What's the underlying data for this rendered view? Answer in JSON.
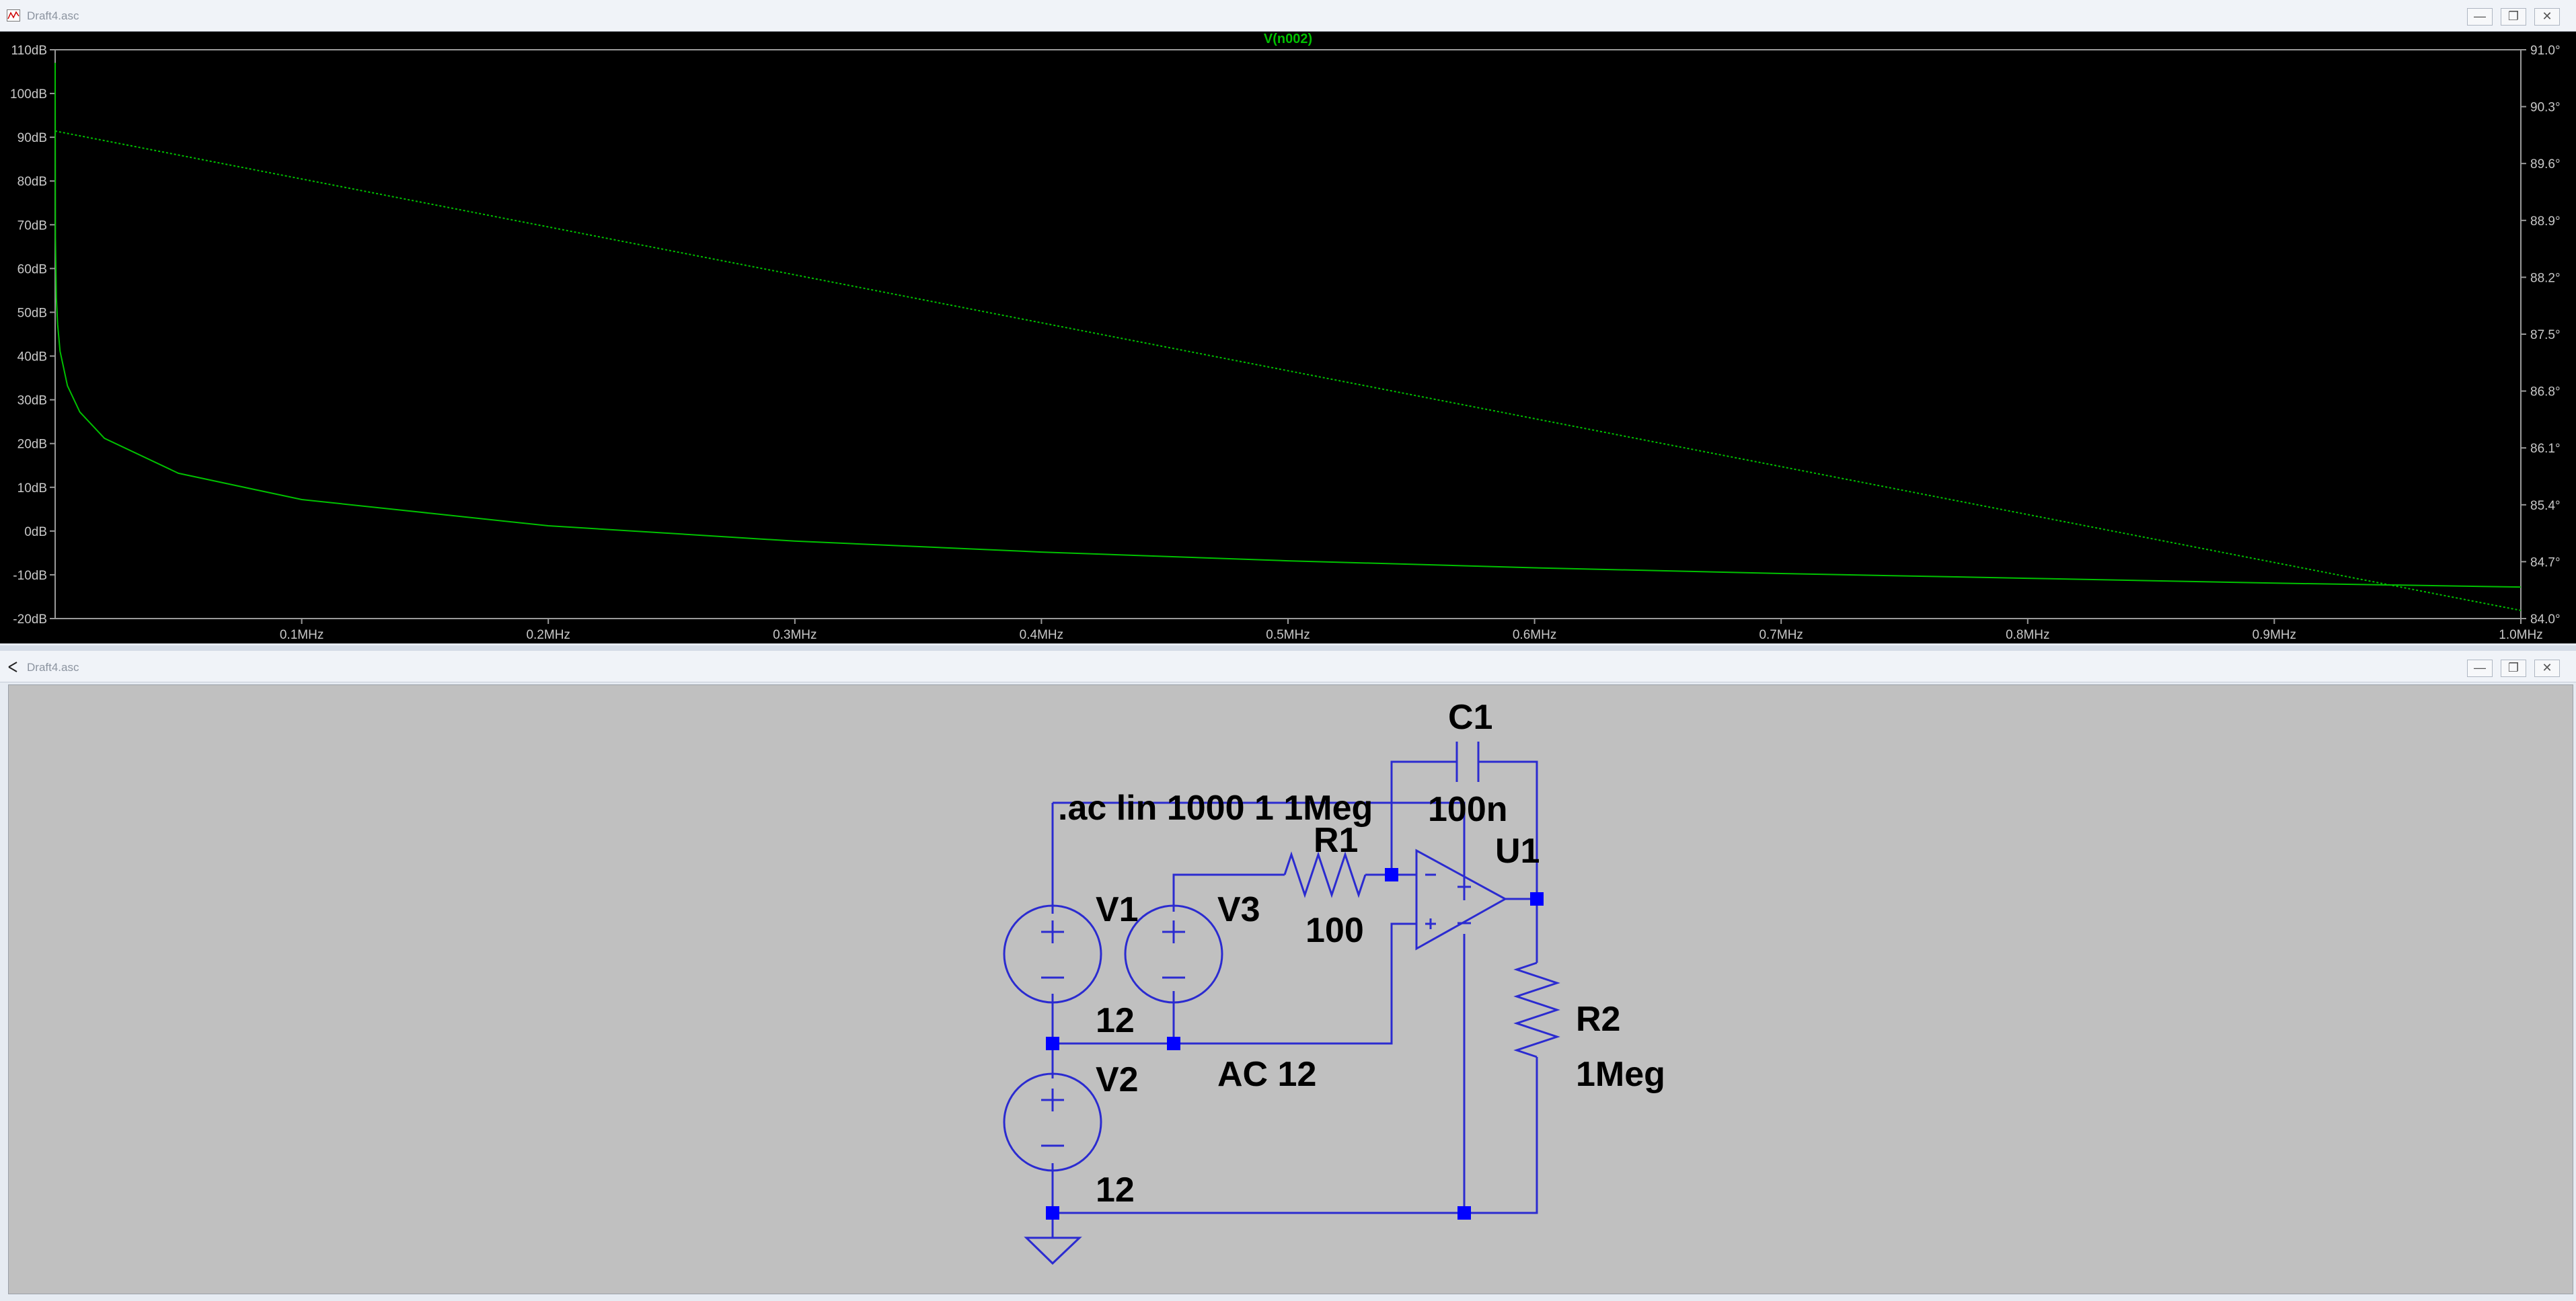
{
  "waveform_window": {
    "title": "Draft4.asc",
    "controls": [
      "—",
      "❐",
      "✕"
    ]
  },
  "schematic_window": {
    "title": "Draft4.asc",
    "controls": [
      "—",
      "❐",
      "✕"
    ]
  },
  "chart_data": {
    "type": "line",
    "title": "V(n002)",
    "xlabel": "",
    "ylabel": "",
    "x_ticks": [
      "0.1MHz",
      "0.2MHz",
      "0.3MHz",
      "0.4MHz",
      "0.5MHz",
      "0.6MHz",
      "0.7MHz",
      "0.8MHz",
      "0.9MHz",
      "1.0MHz"
    ],
    "y_left_ticks": [
      "110dB",
      "100dB",
      "90dB",
      "80dB",
      "70dB",
      "60dB",
      "50dB",
      "40dB",
      "30dB",
      "20dB",
      "10dB",
      "0dB",
      "-10dB",
      "-20dB"
    ],
    "y_right_ticks": [
      "91.0°",
      "90.3°",
      "89.6°",
      "88.9°",
      "88.2°",
      "87.5°",
      "86.8°",
      "86.1°",
      "85.4°",
      "84.7°",
      "84.0°"
    ],
    "xlim_mhz": [
      0,
      1.0
    ],
    "ylim_db": [
      -20,
      110
    ],
    "ylim_deg": [
      84.0,
      91.0
    ],
    "grid": false,
    "color": "#00c000",
    "series": [
      {
        "kind": "magnitude",
        "x_mhz": [
          1e-06,
          0.0001,
          0.0005,
          0.001,
          0.002,
          0.005,
          0.01,
          0.02,
          0.05,
          0.1,
          0.2,
          0.3,
          0.4,
          0.5,
          0.6,
          0.7,
          0.8,
          0.9,
          1.0
        ],
        "y_db": [
          107,
          67,
          53.2,
          47.2,
          41.1,
          33.2,
          27.2,
          21.2,
          13.2,
          7.2,
          1.2,
          -2.3,
          -4.8,
          -6.8,
          -8.4,
          -9.7,
          -10.8,
          -11.9,
          -12.8
        ]
      },
      {
        "kind": "phase",
        "x_mhz": [
          1e-06,
          1.0
        ],
        "y_deg": [
          90.0,
          84.1
        ]
      }
    ]
  },
  "schematic": {
    "directive": ".ac lin 1000 1 1Meg",
    "components": {
      "C1": {
        "name": "C1",
        "value": "100n"
      },
      "R1": {
        "name": "R1",
        "value": "100"
      },
      "R2": {
        "name": "R2",
        "value": "1Meg"
      },
      "U1": {
        "name": "U1"
      },
      "V1": {
        "name": "V1",
        "value": "12"
      },
      "V2": {
        "name": "V2",
        "value": "12"
      },
      "V3": {
        "name": "V3",
        "value": "AC 12"
      }
    },
    "wire_color": "#2b2bd0",
    "node_color": "#0000ff"
  }
}
